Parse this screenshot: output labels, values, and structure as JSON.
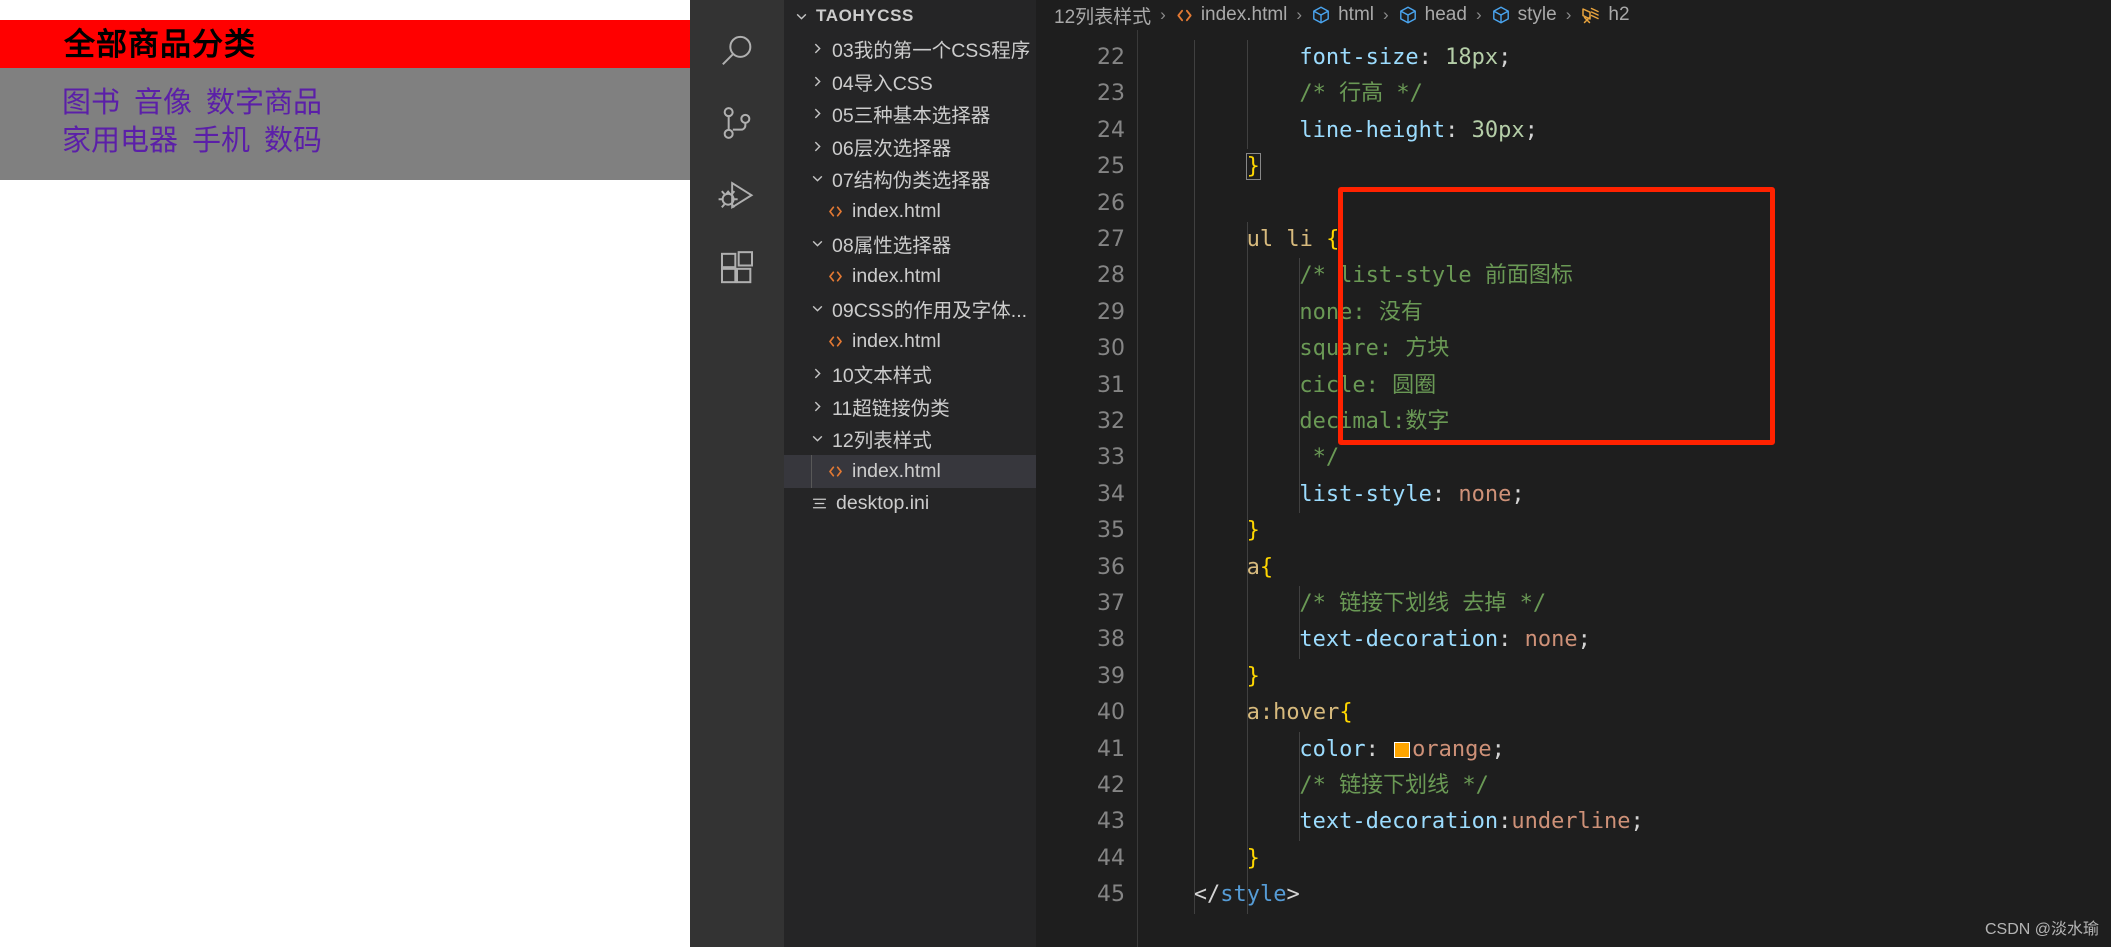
{
  "preview": {
    "banner_title": "全部商品分类",
    "nav_rows": [
      [
        "图书",
        "音像",
        "数字商品"
      ],
      [
        "家用电器",
        "手机",
        "数码"
      ]
    ],
    "colors": {
      "banner_bg": "#ff0000",
      "nav_bg": "#808080",
      "link": "#5b1fa8"
    }
  },
  "activity_bar": {
    "items": [
      {
        "name": "search-icon",
        "label": "Search"
      },
      {
        "name": "source-control-icon",
        "label": "Source Control"
      },
      {
        "name": "run-debug-icon",
        "label": "Run and Debug"
      },
      {
        "name": "extensions-icon",
        "label": "Extensions"
      }
    ]
  },
  "sidebar": {
    "root": {
      "label": "TAOHYCSS",
      "expanded": true
    },
    "items": [
      {
        "label": "03我的第一个CSS程序",
        "type": "folder",
        "expanded": false,
        "indent": 1
      },
      {
        "label": "04导入CSS",
        "type": "folder",
        "expanded": false,
        "indent": 1
      },
      {
        "label": "05三种基本选择器",
        "type": "folder",
        "expanded": false,
        "indent": 1
      },
      {
        "label": "06层次选择器",
        "type": "folder",
        "expanded": false,
        "indent": 1
      },
      {
        "label": "07结构伪类选择器",
        "type": "folder",
        "expanded": true,
        "indent": 1
      },
      {
        "label": "index.html",
        "type": "html",
        "indent": 2
      },
      {
        "label": "08属性选择器",
        "type": "folder",
        "expanded": true,
        "indent": 1
      },
      {
        "label": "index.html",
        "type": "html",
        "indent": 2
      },
      {
        "label": "09CSS的作用及字体...",
        "type": "folder",
        "expanded": true,
        "indent": 1
      },
      {
        "label": "index.html",
        "type": "html",
        "indent": 2
      },
      {
        "label": "10文本样式",
        "type": "folder",
        "expanded": false,
        "indent": 1
      },
      {
        "label": "11超链接伪类",
        "type": "folder",
        "expanded": false,
        "indent": 1
      },
      {
        "label": "12列表样式",
        "type": "folder",
        "expanded": true,
        "indent": 1
      },
      {
        "label": "index.html",
        "type": "html",
        "indent": 2,
        "selected": true
      },
      {
        "label": "desktop.ini",
        "type": "ini",
        "indent": 1
      }
    ]
  },
  "breadcrumbs": [
    {
      "text": "12列表样式",
      "icon": "none"
    },
    {
      "text": "index.html",
      "icon": "html-icon"
    },
    {
      "text": "html",
      "icon": "symbol-field-icon"
    },
    {
      "text": "head",
      "icon": "symbol-field-icon"
    },
    {
      "text": "style",
      "icon": "symbol-field-icon"
    },
    {
      "text": "h2",
      "icon": "symbol-snippet-icon"
    }
  ],
  "editor": {
    "first_line_number": 22,
    "line_numbers": [
      22,
      23,
      24,
      25,
      26,
      27,
      28,
      29,
      30,
      31,
      32,
      33,
      34,
      35,
      36,
      37,
      38,
      39,
      40,
      41,
      42,
      43,
      44,
      45
    ],
    "lines": [
      {
        "n": 22,
        "text": "            font-size: 18px;"
      },
      {
        "n": 23,
        "text": "            /* 行高 */"
      },
      {
        "n": 24,
        "text": "            line-height: 30px;"
      },
      {
        "n": 25,
        "text": "        }"
      },
      {
        "n": 26,
        "text": ""
      },
      {
        "n": 27,
        "text": "        ul li {"
      },
      {
        "n": 28,
        "text": "            /* list-style 前面图标"
      },
      {
        "n": 29,
        "text": "            none: 没有"
      },
      {
        "n": 30,
        "text": "            square: 方块"
      },
      {
        "n": 31,
        "text": "            cicle: 圆圈"
      },
      {
        "n": 32,
        "text": "            decimal:数字"
      },
      {
        "n": 33,
        "text": "             */"
      },
      {
        "n": 34,
        "text": "            list-style: none;"
      },
      {
        "n": 35,
        "text": "        }"
      },
      {
        "n": 36,
        "text": "        a{"
      },
      {
        "n": 37,
        "text": "            /* 链接下划线 去掉 */"
      },
      {
        "n": 38,
        "text": "            text-decoration: none;"
      },
      {
        "n": 39,
        "text": "        }"
      },
      {
        "n": 40,
        "text": "        a:hover{"
      },
      {
        "n": 41,
        "text": "            color: orange;"
      },
      {
        "n": 42,
        "text": "            /* 链接下划线 */"
      },
      {
        "n": 43,
        "text": "            text-decoration:underline;"
      },
      {
        "n": 44,
        "text": "        }"
      },
      {
        "n": 45,
        "text": "    </style>"
      }
    ],
    "color_swatch_value": "#ffa500",
    "annotation_box": {
      "from_line": 27,
      "to_line": 35,
      "color": "#ff2200"
    }
  },
  "watermark": "CSDN @淡水瑜"
}
